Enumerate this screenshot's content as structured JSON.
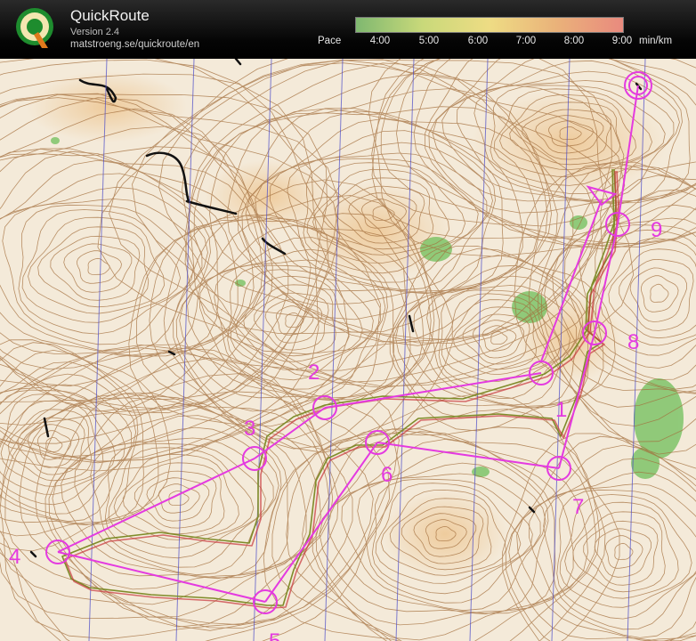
{
  "app": {
    "logo_letter": "Q",
    "name": "QuickRoute",
    "version": "Version 2.4",
    "url": "matstroeng.se/quickroute/en"
  },
  "pace_legend": {
    "label": "Pace",
    "ticks": [
      "4:00",
      "5:00",
      "6:00",
      "7:00",
      "8:00",
      "9:00"
    ],
    "unit": "min/km",
    "gradient_colors": [
      "#7fb870",
      "#c9d97a",
      "#eedc84",
      "#eab27a",
      "#e98a7e"
    ]
  },
  "map": {
    "course_color": "#e43ae0",
    "route_colors": [
      "#7f8c2a",
      "#c8353a"
    ],
    "background_color": "#f4ead9",
    "contour_color": "#9a6a3a",
    "control_labels": [
      "1",
      "2",
      "3",
      "4",
      "5",
      "6",
      "7",
      "8",
      "9"
    ]
  }
}
